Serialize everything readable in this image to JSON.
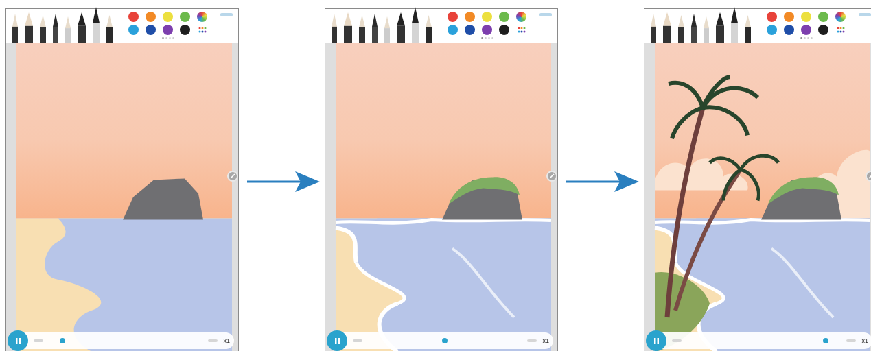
{
  "palette": [
    {
      "color": "#e8433a"
    },
    {
      "color": "#f28a26"
    },
    {
      "color": "#ece03f"
    },
    {
      "color": "#6cba4c"
    },
    {
      "color": "#2aa1db"
    },
    {
      "color": "#1f4ea8"
    },
    {
      "color": "#7d3fae"
    },
    {
      "color": "#1e1e1e"
    }
  ],
  "screens": [
    {
      "kind": "rock",
      "playback": {
        "level": 0.05,
        "speed": "x1"
      }
    },
    {
      "kind": "waves",
      "playback": {
        "level": 0.5,
        "speed": "x1"
      }
    },
    {
      "kind": "palms",
      "playback": {
        "level": 0.94,
        "speed": "x1"
      }
    }
  ]
}
